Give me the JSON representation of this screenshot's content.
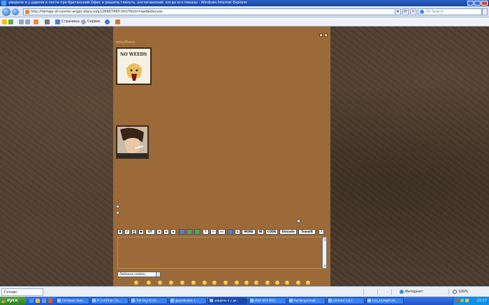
{
  "window": {
    "title": "увидела я у дарков в посте про британский Офис и решила глянуть. англичанский, когда его показы - Windows Internet Explorer"
  },
  "address_bar": {
    "url": "http://twinge-of-cosmic-angst.diary.ru/p126907493.htm?from=last&discuss",
    "search_placeholder": "Q9 Search"
  },
  "command_bar": {
    "page_label": "Страница",
    "tools_label": "Сервис"
  },
  "page": {
    "top_right_meta": "",
    "post1": {
      "username": "onlyMoon",
      "avatar_text": "NO WEEDS",
      "meta": ""
    },
    "post2": {
      "label_left": "",
      "username": "",
      "meta": ""
    },
    "reply_form": {
      "toolbar_buttons": [
        "B",
        "I",
        "U",
        "S",
        "OT",
        "MORE",
        "NI",
        "CODE",
        "Unicode",
        "Translit",
        "?"
      ],
      "smiley_select": "Любимые смайлы"
    }
  },
  "status_bar": {
    "done_text": "Готово",
    "zone_text": "Интернет",
    "zoom_text": "100%"
  },
  "taskbar": {
    "start_label": "пуск",
    "tasks": [
      "Сетевые подк...",
      "P: [+it]Trian Tru...",
      "The Guy IV On ...",
      "@дневники + ...",
      "увидела я у да...",
      "[565-057-950] ...",
      "Англо-русский ...",
      "µTorrent 1.8.1",
      "Lisa_trumpet.all..."
    ],
    "clock": "23:17"
  },
  "colors": {
    "page_column": "#9b6a38",
    "background": "#4b3b2d",
    "titlebar": "#2a5fc7",
    "taskbar": "#245edc"
  }
}
